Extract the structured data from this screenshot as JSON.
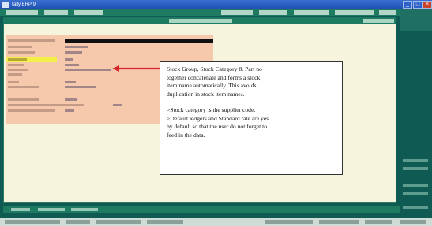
{
  "window": {
    "title": "Tally ERP 9"
  },
  "callout": {
    "lines_1": [
      "Stock Group, Stock Category & Part no",
      "together concatenate and forms a stock",
      "item name automatically.  This avoids",
      "duplication in stock item names."
    ],
    "lines_2": [
      ">Stock category is the supplier code.",
      ">Default ledgers and Standard rate are yes",
      "by default so that the user do not forget to",
      "feed in the data."
    ]
  },
  "colors": {
    "form_bg": "#f6c9ad",
    "highlight": "#f3f04a",
    "arrow": "#d3262c",
    "panel_bg": "#f6f4dc",
    "accent": "#1f7a62"
  },
  "icons": [
    "arrow-left-icon"
  ]
}
